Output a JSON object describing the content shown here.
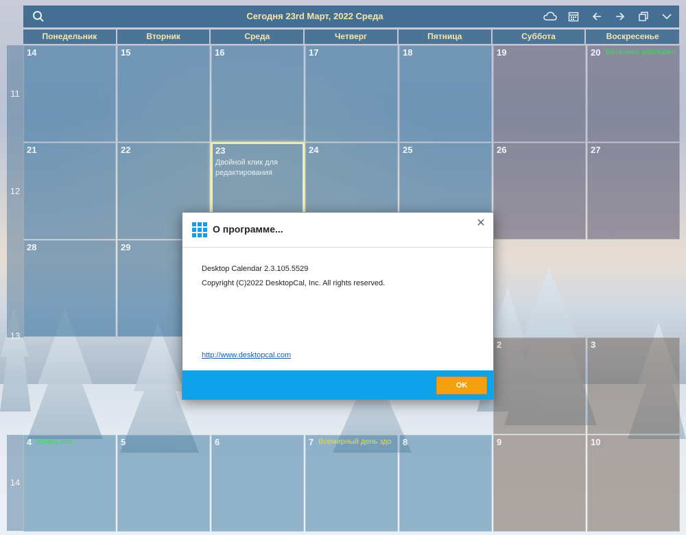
{
  "toolbar": {
    "title": "Сегодня 23rd Март, 2022 Среда",
    "icons": [
      "search-icon",
      "cloud-icon",
      "calendar-icon",
      "arrow-left-icon",
      "arrow-right-icon",
      "restore-window-icon",
      "chevron-down-icon"
    ]
  },
  "weekdays": [
    "Понедельник",
    "Вторник",
    "Среда",
    "Четверг",
    "Пятница",
    "Суббота",
    "Воскресенье"
  ],
  "week_numbers": [
    "11",
    "12",
    "13",
    "14"
  ],
  "weeks": [
    {
      "days": [
        "14",
        "15",
        "16",
        "17",
        "18",
        "19",
        "20"
      ]
    },
    {
      "days": [
        "21",
        "22",
        "23",
        "24",
        "25",
        "26",
        "27"
      ]
    },
    {
      "days": [
        "28",
        "29",
        "",
        "",
        "",
        "",
        ""
      ]
    },
    {
      "days": [
        "",
        "",
        "",
        "",
        "",
        "2",
        "3"
      ]
    },
    {
      "days": [
        "4",
        "5",
        "6",
        "7",
        "8",
        "9",
        "10"
      ]
    }
  ],
  "events": {
    "sun20": "Весеннее равноден",
    "mon4": "Конец зим",
    "thu7": "Всемирный день здо"
  },
  "today_hint": "Двойной клик для редактирования",
  "colors": {
    "toolbar": "#2d5f87",
    "title_text": "#f7e6a8",
    "event_green": "#3fd85a",
    "event_yellow": "#f1d34a",
    "dialog_footer": "#0fa2ea",
    "ok_button": "#f5a00f"
  },
  "dialog": {
    "title": "О программе...",
    "version_line": "Desktop Calendar  2.3.105.5529",
    "copyright": "Copyright (C)2022 DesktopCal, Inc. All rights reserved.",
    "link": "http://www.desktopcal.com",
    "ok_label": "OK",
    "close_icon": "close-icon",
    "app_icon": "app-grid-icon"
  }
}
